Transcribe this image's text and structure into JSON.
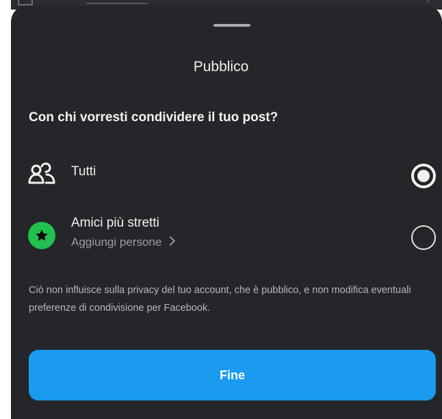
{
  "sheet": {
    "title": "Pubblico",
    "question": "Con chi vorresti condividere il tuo post?"
  },
  "options": [
    {
      "label": "Tutti",
      "icon": "people-icon",
      "selected": true
    },
    {
      "label": "Amici più stretti",
      "sublabel": "Aggiungi persone",
      "icon": "star-icon",
      "icon_color": "#22c04f",
      "selected": false
    }
  ],
  "disclaimer": "Ciò non influisce sulla privacy del tuo account, che è pubblico, e non modifica eventuali preferenze di condivisione per Facebook.",
  "done_button": {
    "label": "Fine",
    "color": "#1a9bf0"
  },
  "colors": {
    "sheet_background": "#25262a",
    "text_primary": "#f3f3f3",
    "text_secondary": "#9c9da2"
  }
}
